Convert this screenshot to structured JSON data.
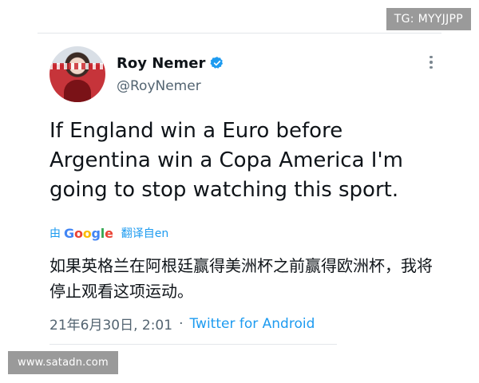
{
  "overlay": {
    "tg_badge": "TG: MYYJJPP",
    "watermark": "www.satadn.com"
  },
  "user": {
    "display_name": "Roy Nemer",
    "handle": "@RoyNemer",
    "verified": true
  },
  "tweet": {
    "text": "If England win a Euro before Argentina win a Copa America I'm going to stop watching this sport.",
    "translated_by": "由",
    "translator": "Google",
    "translate_label": "翻译自en",
    "translated_text": "如果英格兰在阿根廷赢得美洲杯之前赢得欧洲杯，我将停止观看这项运动。",
    "timestamp": "21年6月30日, 2:01",
    "separator": "·",
    "source": "Twitter for Android"
  },
  "colors": {
    "accent": "#1d9bf0",
    "text_primary": "#0f1419",
    "text_secondary": "#536471"
  },
  "icons": {
    "verified": "verified-badge-icon",
    "more": "more-vertical-icon"
  }
}
